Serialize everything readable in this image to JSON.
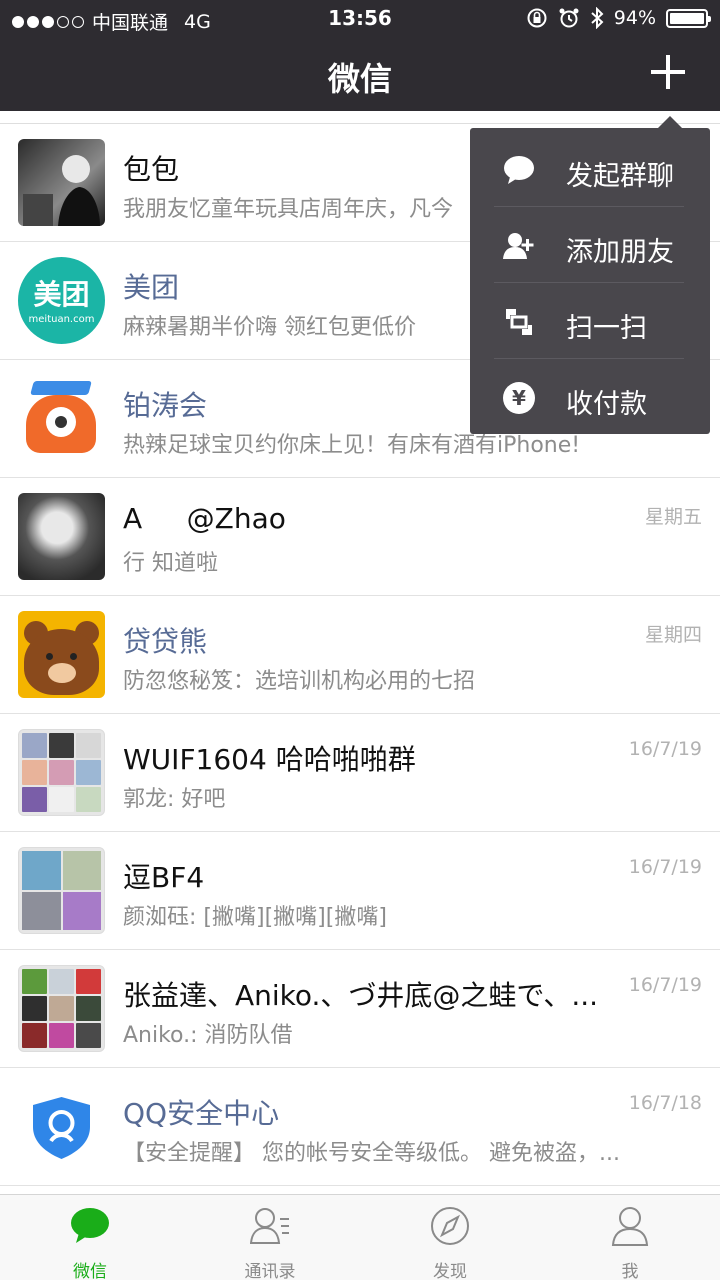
{
  "status_bar": {
    "carrier": "中国联通",
    "network": "4G",
    "time": "13:56",
    "battery": "94%",
    "battery_level": 0.94
  },
  "nav": {
    "title": "微信"
  },
  "chats": [
    {
      "name": "包包",
      "message": "我朋友忆童年玩具店周年庆，凡今",
      "date": "",
      "name_style": "normal"
    },
    {
      "name": "美团",
      "message": "麻辣暑期半价嗨 领红包更低价",
      "date": "",
      "name_style": "service",
      "avatar_text": "美团",
      "avatar_subtext": "meituan.com"
    },
    {
      "name": "铂涛会",
      "message": "热辣足球宝贝约你床上见！有床有酒有iPhone!",
      "date": "",
      "name_style": "service"
    },
    {
      "name": "A     @Zhao",
      "message": "行 知道啦",
      "date": "星期五",
      "name_style": "normal"
    },
    {
      "name": "贷贷熊",
      "message": "防忽悠秘笈：选培训机构必用的七招",
      "date": "星期四",
      "name_style": "service"
    },
    {
      "name": "WUIF1604 哈哈啪啪群",
      "message": "郭龙: 好吧",
      "date": "16/7/19",
      "name_style": "normal"
    },
    {
      "name": "逗BF4",
      "message": "颜洳砡: [撇嘴][撇嘴][撇嘴]",
      "date": "16/7/19",
      "name_style": "normal"
    },
    {
      "name": "张益達、Aniko.、づ井底@之蛙で、...",
      "message": "Aniko.: 消防队借",
      "date": "16/7/19",
      "name_style": "normal"
    },
    {
      "name": "QQ安全中心",
      "message": "【安全提醒】 您的帐号安全等级低。 避免被盗，...",
      "date": "16/7/18",
      "name_style": "service"
    }
  ],
  "popup_menu": {
    "items": [
      {
        "label": "发起群聊",
        "icon": "chat-bubble-icon"
      },
      {
        "label": "添加朋友",
        "icon": "add-friend-icon"
      },
      {
        "label": "扫一扫",
        "icon": "scan-icon"
      },
      {
        "label": "收付款",
        "icon": "yuan-icon",
        "glyph": "¥"
      }
    ]
  },
  "tabs": [
    {
      "label": "微信",
      "icon": "chat-icon",
      "active": true
    },
    {
      "label": "通讯录",
      "icon": "contacts-icon",
      "active": false
    },
    {
      "label": "发现",
      "icon": "compass-icon",
      "active": false
    },
    {
      "label": "我",
      "icon": "person-icon",
      "active": false
    }
  ],
  "colors": {
    "header": "#2e2c31",
    "popup": "#49474c",
    "accent_green": "#1aad19",
    "service_name": "#576b95",
    "meituan": "#1bb5a6"
  }
}
